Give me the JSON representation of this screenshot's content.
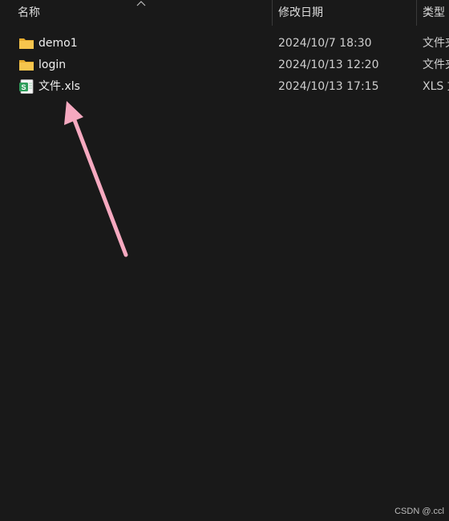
{
  "columns": {
    "name": "名称",
    "modified": "修改日期",
    "type": "类型"
  },
  "files": [
    {
      "name": "demo1",
      "modified": "2024/10/7 18:30",
      "type": "文件夹",
      "icon": "folder-icon"
    },
    {
      "name": "login",
      "modified": "2024/10/13 12:20",
      "type": "文件夹",
      "icon": "folder-icon"
    },
    {
      "name": "文件.xls",
      "modified": "2024/10/13 17:15",
      "type": "XLS 文件",
      "icon": "spreadsheet-icon"
    }
  ],
  "watermark": "CSDN @.ccl",
  "colors": {
    "background": "#191919",
    "folder": "#f4c14a",
    "spreadsheet": "#2e9d5a",
    "annotation_arrow": "#f6a9c0"
  }
}
